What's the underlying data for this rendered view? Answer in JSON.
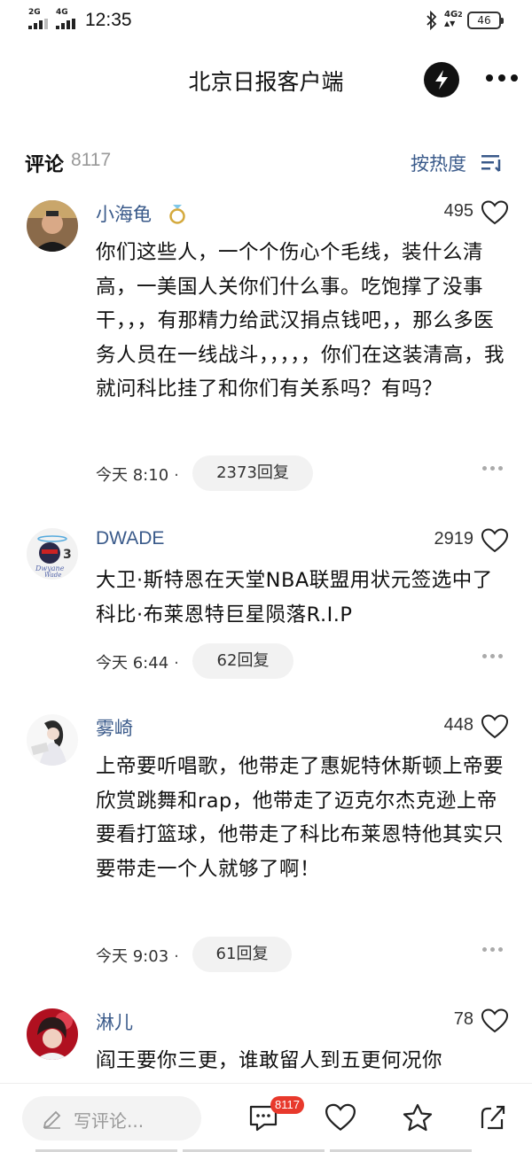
{
  "status_bar": {
    "signal1": "2G",
    "signal2": "4G",
    "time": "12:35",
    "network": "4G",
    "network_sub": "2",
    "battery": "46"
  },
  "header": {
    "title": "北京日报客户端"
  },
  "comments_header": {
    "title": "评论",
    "count": "8117",
    "sort_label": "按热度"
  },
  "comments": [
    {
      "username": "小海龟",
      "likes": "495",
      "text": "你们这些人，一个个伤心个毛线，装什么清高，一美国人关你们什么事。吃饱撑了没事干，，，有那精力给武汉捐点钱吧，，那么多医务人员在一线战斗，，，，，你们在这装清高，我就问科比挂了和你们有关系吗？有吗？",
      "time": "今天 8:10",
      "replies": "2373回复"
    },
    {
      "username": "DWADE",
      "likes": "2919",
      "text": "大卫·斯特恩在天堂NBA联盟用状元签选中了科比·布莱恩特巨星陨落R.I.P",
      "time": "今天 6:44",
      "replies": "62回复"
    },
    {
      "username": "雾崎",
      "likes": "448",
      "text": "上帝要听唱歌，他带走了惠妮特休斯顿上帝要欣赏跳舞和rap，他带走了迈克尔杰克逊上帝要看打篮球，他带走了科比布莱恩特他其实只要带走一个人就够了啊！",
      "time": "今天 9:03",
      "replies": "61回复"
    },
    {
      "username": "淋儿",
      "likes": "78",
      "text": "阎王要你三更，谁敢留人到五更何况你",
      "time": "",
      "replies": ""
    }
  ],
  "bottom_bar": {
    "write_placeholder": "写评论...",
    "comment_count_badge": "8117"
  },
  "colors": {
    "accent_blue": "#3a5a8a",
    "badge_red": "#e8392c"
  }
}
